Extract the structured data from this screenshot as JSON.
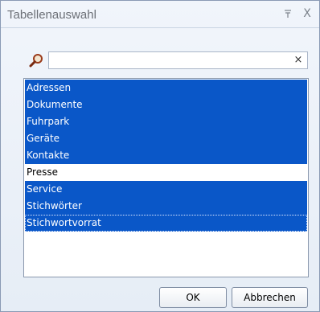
{
  "window": {
    "title": "Tabellenauswahl"
  },
  "titlebar": {
    "pin_glyph": "⊤",
    "close_glyph": "X"
  },
  "search": {
    "value": "",
    "placeholder": "",
    "clear_glyph": "×"
  },
  "list": {
    "items": [
      {
        "label": "Adressen",
        "selected": true
      },
      {
        "label": "Dokumente",
        "selected": true
      },
      {
        "label": "Fuhrpark",
        "selected": true
      },
      {
        "label": "Geräte",
        "selected": true
      },
      {
        "label": "Kontakte",
        "selected": true
      },
      {
        "label": "Presse",
        "selected": false
      },
      {
        "label": "Service",
        "selected": true
      },
      {
        "label": "Stichwörter",
        "selected": true
      },
      {
        "label": "Stichwortvorrat",
        "selected": true
      }
    ]
  },
  "buttons": {
    "ok": "OK",
    "cancel": "Abbrechen"
  },
  "colors": {
    "selection": "#0a57c8",
    "selection_text": "#ffffff"
  }
}
